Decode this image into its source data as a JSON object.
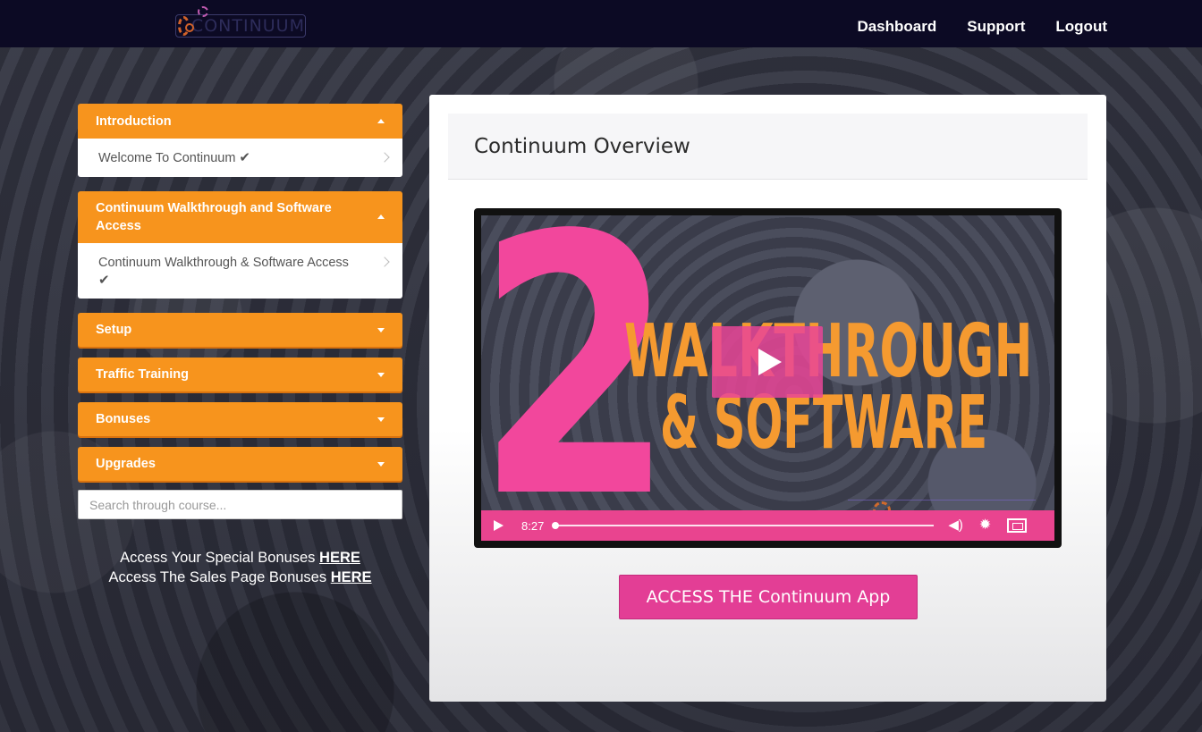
{
  "header": {
    "logo_text": "CONTINUUM",
    "nav": [
      {
        "label": "Dashboard"
      },
      {
        "label": "Support"
      },
      {
        "label": "Logout"
      }
    ]
  },
  "sidebar": {
    "sections": [
      {
        "title": "Introduction",
        "expanded": true,
        "lessons": [
          {
            "label": "Welcome To Continuum",
            "completed": true
          }
        ]
      },
      {
        "title": "Continuum Walkthrough and Software Access",
        "expanded": true,
        "lessons": [
          {
            "label": "Continuum Walkthrough & Software Access",
            "completed": true
          }
        ]
      },
      {
        "title": "Setup",
        "expanded": false
      },
      {
        "title": "Traffic Training",
        "expanded": false
      },
      {
        "title": "Bonuses",
        "expanded": false
      },
      {
        "title": "Upgrades",
        "expanded": false
      }
    ],
    "search": {
      "placeholder": "Search through course..."
    },
    "bonus_lines": [
      {
        "text": "Access Your Special Bonuses",
        "link": "HERE"
      },
      {
        "text": "Access The Sales Page Bonuses",
        "link": "HERE"
      }
    ]
  },
  "main": {
    "title": "Continuum Overview",
    "video": {
      "big_number": "2",
      "line1": "WALKTHROUGH",
      "line2": "& SOFTWARE",
      "time": "8:27",
      "progress": 0.0
    },
    "cta_label": "ACCESS THE Continuum App"
  },
  "colors": {
    "header_bg": "#0c0a24",
    "accordion_orange": "#f7941d",
    "pink": "#e33e95",
    "video_text_orange": "#f59a30"
  }
}
